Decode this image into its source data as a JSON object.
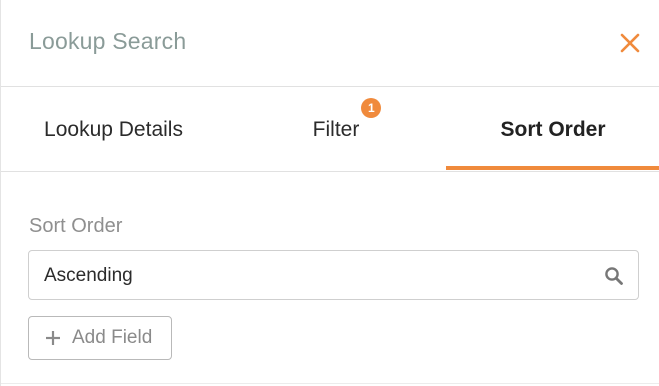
{
  "header": {
    "title": "Lookup Search",
    "close_icon": "close-icon"
  },
  "tabs": [
    {
      "label": "Lookup Details",
      "active": false
    },
    {
      "label": "Filter",
      "active": false,
      "badge": "1"
    },
    {
      "label": "Sort Order",
      "active": true
    }
  ],
  "sort_order": {
    "label": "Sort Order",
    "value": "Ascending",
    "icon": "search-icon"
  },
  "add_field": {
    "label": "Add Field",
    "icon": "plus-icon"
  },
  "colors": {
    "accent": "#f08a3c",
    "title": "#8a9b98"
  }
}
